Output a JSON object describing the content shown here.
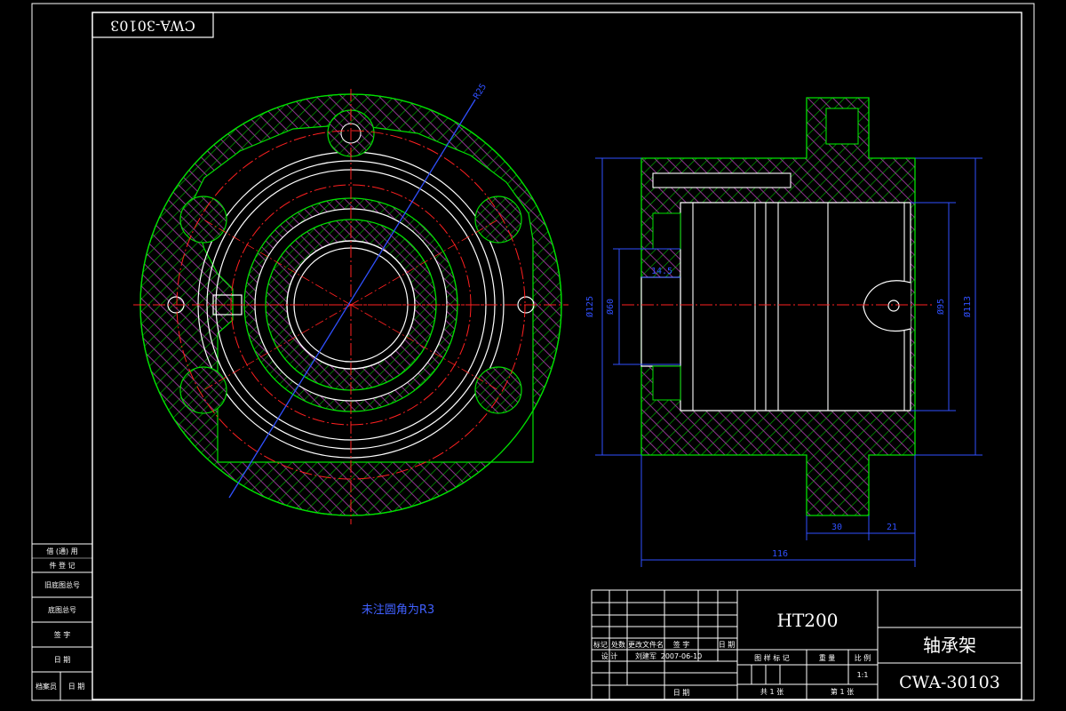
{
  "drawing_code": "CWA-30103",
  "note": "未注圆角为R3",
  "dims": {
    "radial": "R25",
    "w116": "116",
    "w30": "30",
    "w21": "21",
    "d14_5": "14.5",
    "phi_left_outer": "Ø125",
    "phi_left_inner": "Ø60",
    "phi_right_inner": "Ø95",
    "phi_right_outer": "Ø113"
  },
  "side_block": {
    "r1": "借 (通) 用",
    "r1b": "件 登 记",
    "r2": "旧底图总号",
    "r3": "底图总号",
    "r4": "签  字",
    "r5": "日  期",
    "r6a": "档案员",
    "r6b": "日 期"
  },
  "title_block": {
    "material": "HT200",
    "part_name": "轴承架",
    "code": "CWA-30103",
    "hdr_mark": "标记",
    "hdr_count": "处数",
    "hdr_change": "更改文件名",
    "hdr_sign": "签 字",
    "hdr_date": "日 期",
    "design": "设 计",
    "designer": "刘建军",
    "design_date": "2007-06-10",
    "stage": "图 样 标 记",
    "weight": "重 量",
    "scale": "比 例",
    "scale_val": "1:1",
    "approve_date": "日 期",
    "total_sheets": "共 1 张",
    "sheet_no": "第 1 张"
  },
  "colors": {
    "frame": "#ffffff",
    "section_outline": "#00e000",
    "hatch": "#00c000",
    "hatch_cross": "#ff40ff",
    "center_line": "#ff2020",
    "dimension": "#3050ff",
    "note": "#4060ff"
  }
}
